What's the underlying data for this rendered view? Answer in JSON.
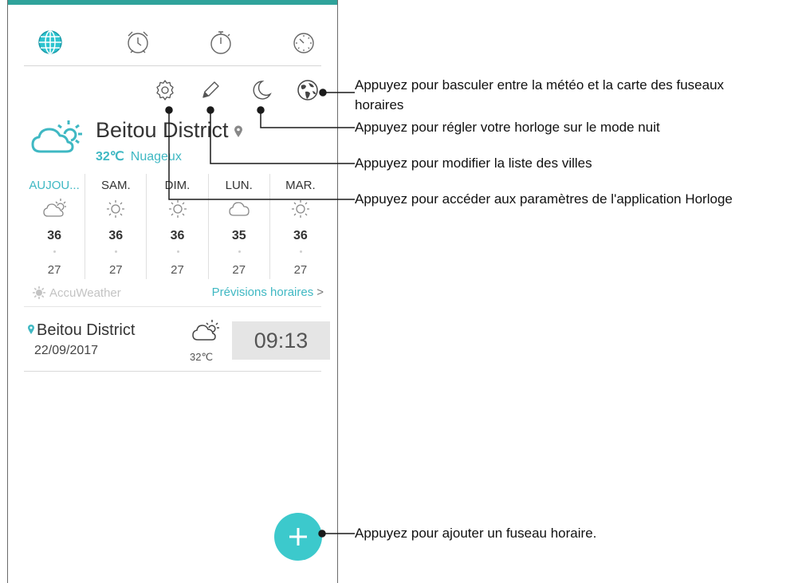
{
  "tabs": [
    {
      "icon": "globe-icon"
    },
    {
      "icon": "alarm-icon"
    },
    {
      "icon": "stopwatch-icon"
    },
    {
      "icon": "timer-icon"
    }
  ],
  "toolbar": {
    "icons": [
      "settings-icon",
      "edit-icon",
      "night-mode-icon",
      "world-map-icon"
    ]
  },
  "weather": {
    "city": "Beitou District",
    "temperature": "32℃",
    "condition": "Nuageux",
    "forecast": [
      {
        "day": "AUJOU...",
        "icon": "partly-cloudy",
        "high": "36",
        "low": "27"
      },
      {
        "day": "SAM.",
        "icon": "sunny",
        "high": "36",
        "low": "27"
      },
      {
        "day": "DIM.",
        "icon": "sunny",
        "high": "36",
        "low": "27"
      },
      {
        "day": "LUN.",
        "icon": "cloudy",
        "high": "35",
        "low": "27"
      },
      {
        "day": "MAR.",
        "icon": "sunny",
        "high": "36",
        "low": "27"
      }
    ],
    "provider": "AccuWeather",
    "hourly_link": "Prévisions horaires",
    "hourly_chevron": ">"
  },
  "clocks": [
    {
      "city": "Beitou District",
      "date": "22/09/2017",
      "temperature": "32℃",
      "time": "09:13"
    }
  ],
  "fab": {
    "label": "+"
  },
  "callouts": {
    "map_toggle": "Appuyez pour basculer entre la météo et la carte des fuseaux\nhoraires",
    "night_mode": "Appuyez pour régler votre horloge sur le mode nuit",
    "edit_cities": "Appuyez pour modifier la liste des villes",
    "settings": "Appuyez pour accéder aux paramètres de l'application Horloge",
    "add_timezone": "Appuyez pour ajouter un fuseau horaire."
  },
  "colors": {
    "accent": "#3fb8c3",
    "fab": "#3cc9cc",
    "statusbar": "#2fa39b",
    "text": "#333333",
    "muted": "#c3c3c3"
  }
}
